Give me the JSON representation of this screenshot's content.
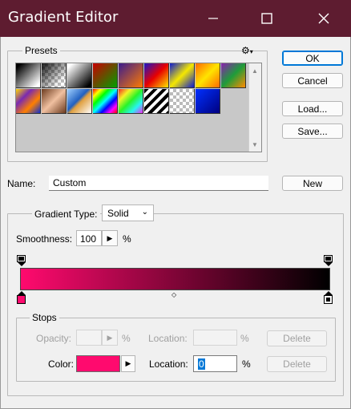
{
  "window": {
    "title": "Gradient Editor"
  },
  "presets": {
    "label": "Presets",
    "swatches": [
      {
        "name": "black-white",
        "bg": "linear-gradient(135deg,#000 10%,#fff 90%)"
      },
      {
        "name": "black-transparent",
        "bg": "checker-fade"
      },
      {
        "name": "white-black",
        "bg": "linear-gradient(135deg,#fff 10%,#000 90%)"
      },
      {
        "name": "red-green",
        "bg": "linear-gradient(135deg,#c80000,#00a000)"
      },
      {
        "name": "violet-orange",
        "bg": "linear-gradient(135deg,#3a1c8f,#ff7a00)"
      },
      {
        "name": "blue-red-yellow",
        "bg": "linear-gradient(135deg,#1a14c8,#e80000,#ffe800)"
      },
      {
        "name": "blue-yellow-blue",
        "bg": "linear-gradient(135deg,#0c1ad0,#f5e800 50%,#0c1ad0)"
      },
      {
        "name": "orange-yellow-orange",
        "bg": "linear-gradient(135deg,#ff6a00,#ffe400 50%,#ff6a00)"
      },
      {
        "name": "violet-green-orange",
        "bg": "linear-gradient(135deg,#8a1fb0,#1e9c3a 50%,#ff8c00)"
      },
      {
        "name": "yellow-violet-orange-blue",
        "bg": "linear-gradient(135deg,#ffd800,#7a2ab0 33%,#ff8000 66%,#1030d0)"
      },
      {
        "name": "copper",
        "bg": "linear-gradient(135deg,#6b3a1e,#f0c0a0 50%,#6b3a1e)"
      },
      {
        "name": "chrome",
        "bg": "linear-gradient(135deg,#a0d0ff,#2060c0 45%,#e0a040 55%,#fff)"
      },
      {
        "name": "spectrum",
        "bg": "linear-gradient(135deg,#f00,#ff0,#0f0,#0ff,#00f,#f0f,#f00)"
      },
      {
        "name": "transparent-rainbow",
        "bg": "linear-gradient(135deg,rgba(255,0,0,.8),rgba(255,255,0,.8),rgba(0,255,0,.8),rgba(0,255,255,.8),rgba(255,0,255,.8))"
      },
      {
        "name": "transparent-stripes",
        "bg": "repeating-linear-gradient(135deg,#000 0 4px,#fff 4px 8px)"
      },
      {
        "name": "transparent-checker",
        "bg": "checker"
      },
      {
        "name": "blue-navy",
        "bg": "linear-gradient(135deg,#0030ff,#000080)"
      }
    ]
  },
  "buttons": {
    "ok": "OK",
    "cancel": "Cancel",
    "load": "Load...",
    "save": "Save...",
    "new": "New"
  },
  "name": {
    "label": "Name:",
    "value": "Custom"
  },
  "gradient": {
    "type_label": "Gradient Type:",
    "type_value": "Solid",
    "smoothness_label": "Smoothness:",
    "smoothness_value": "100",
    "smoothness_unit": "%",
    "bar_colors": [
      "#ff0a6e",
      "#000000"
    ]
  },
  "stops": {
    "label": "Stops",
    "opacity_label": "Opacity:",
    "opacity_unit": "%",
    "opacity_location_label": "Location:",
    "opacity_location_unit": "%",
    "delete_label": "Delete",
    "color_label": "Color:",
    "color_value": "#ff0a6e",
    "color_location_label": "Location:",
    "color_location_value": "0",
    "color_location_unit": "%"
  },
  "colors": {
    "titlebar": "#5e1c30",
    "focus": "#0078d7"
  }
}
